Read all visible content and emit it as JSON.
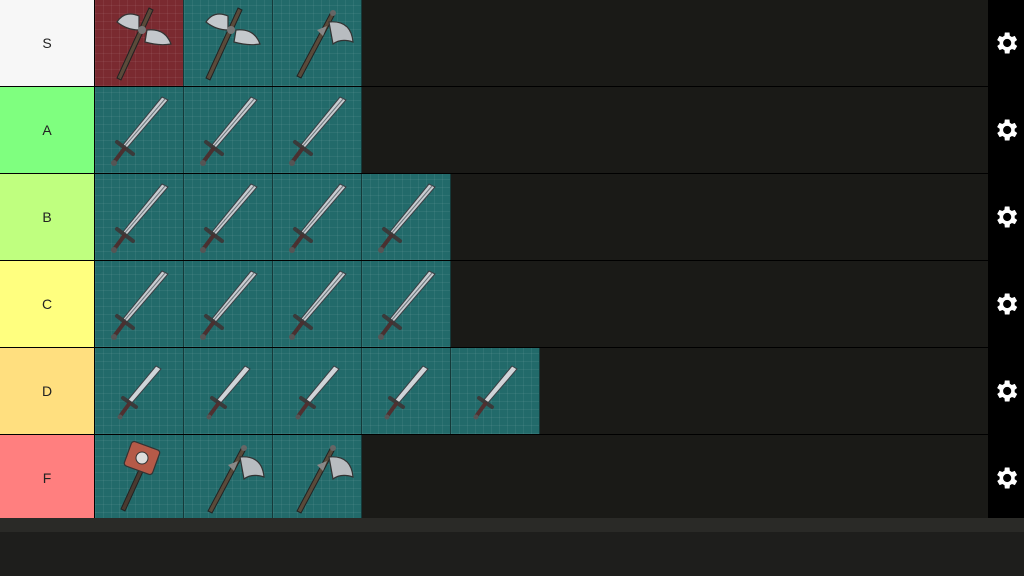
{
  "tiers": [
    {
      "label": "S",
      "color": "#f7f7f7",
      "items": [
        {
          "name": "axe-double-red",
          "kind": "axe2",
          "bg": "red"
        },
        {
          "name": "axe-double-steel",
          "kind": "axe2",
          "bg": "teal"
        },
        {
          "name": "axe-single-dark",
          "kind": "axe1",
          "bg": "teal"
        }
      ]
    },
    {
      "label": "A",
      "color": "#7fff7f",
      "items": [
        {
          "name": "sword-long-steel",
          "kind": "sword",
          "bg": "teal"
        },
        {
          "name": "sword-long-dark",
          "kind": "sword",
          "bg": "teal"
        },
        {
          "name": "sword-serrated-dark",
          "kind": "sword",
          "bg": "teal"
        }
      ]
    },
    {
      "label": "B",
      "color": "#bfff7f",
      "items": [
        {
          "name": "sword-red-hilt",
          "kind": "sword",
          "bg": "teal"
        },
        {
          "name": "sword-spiked-gold",
          "kind": "sword",
          "bg": "teal"
        },
        {
          "name": "sword-blue-blade",
          "kind": "sword",
          "bg": "teal"
        },
        {
          "name": "sword-dark-broad",
          "kind": "sword",
          "bg": "teal"
        }
      ]
    },
    {
      "label": "C",
      "color": "#ffff7f",
      "items": [
        {
          "name": "sword-broad-steel",
          "kind": "sword",
          "bg": "teal"
        },
        {
          "name": "sword-rapier",
          "kind": "sword",
          "bg": "teal"
        },
        {
          "name": "sword-gold-hilt",
          "kind": "sword",
          "bg": "teal"
        },
        {
          "name": "sword-thin-steel",
          "kind": "sword",
          "bg": "teal"
        }
      ]
    },
    {
      "label": "D",
      "color": "#ffdf7f",
      "items": [
        {
          "name": "dagger-pink",
          "kind": "dagger",
          "bg": "teal"
        },
        {
          "name": "dagger-silver",
          "kind": "dagger",
          "bg": "teal"
        },
        {
          "name": "sword-short-red",
          "kind": "dagger",
          "bg": "teal"
        },
        {
          "name": "sword-gold-guard",
          "kind": "dagger",
          "bg": "teal"
        },
        {
          "name": "dagger-plain",
          "kind": "dagger",
          "bg": "teal"
        }
      ]
    },
    {
      "label": "F",
      "color": "#ff7f7f",
      "items": [
        {
          "name": "hammer-copper",
          "kind": "hammer",
          "bg": "teal"
        },
        {
          "name": "axe-curved",
          "kind": "axe1",
          "bg": "teal"
        },
        {
          "name": "axe-green-broad",
          "kind": "axe1",
          "bg": "teal"
        }
      ]
    }
  ],
  "settings_icon": "gear-icon"
}
